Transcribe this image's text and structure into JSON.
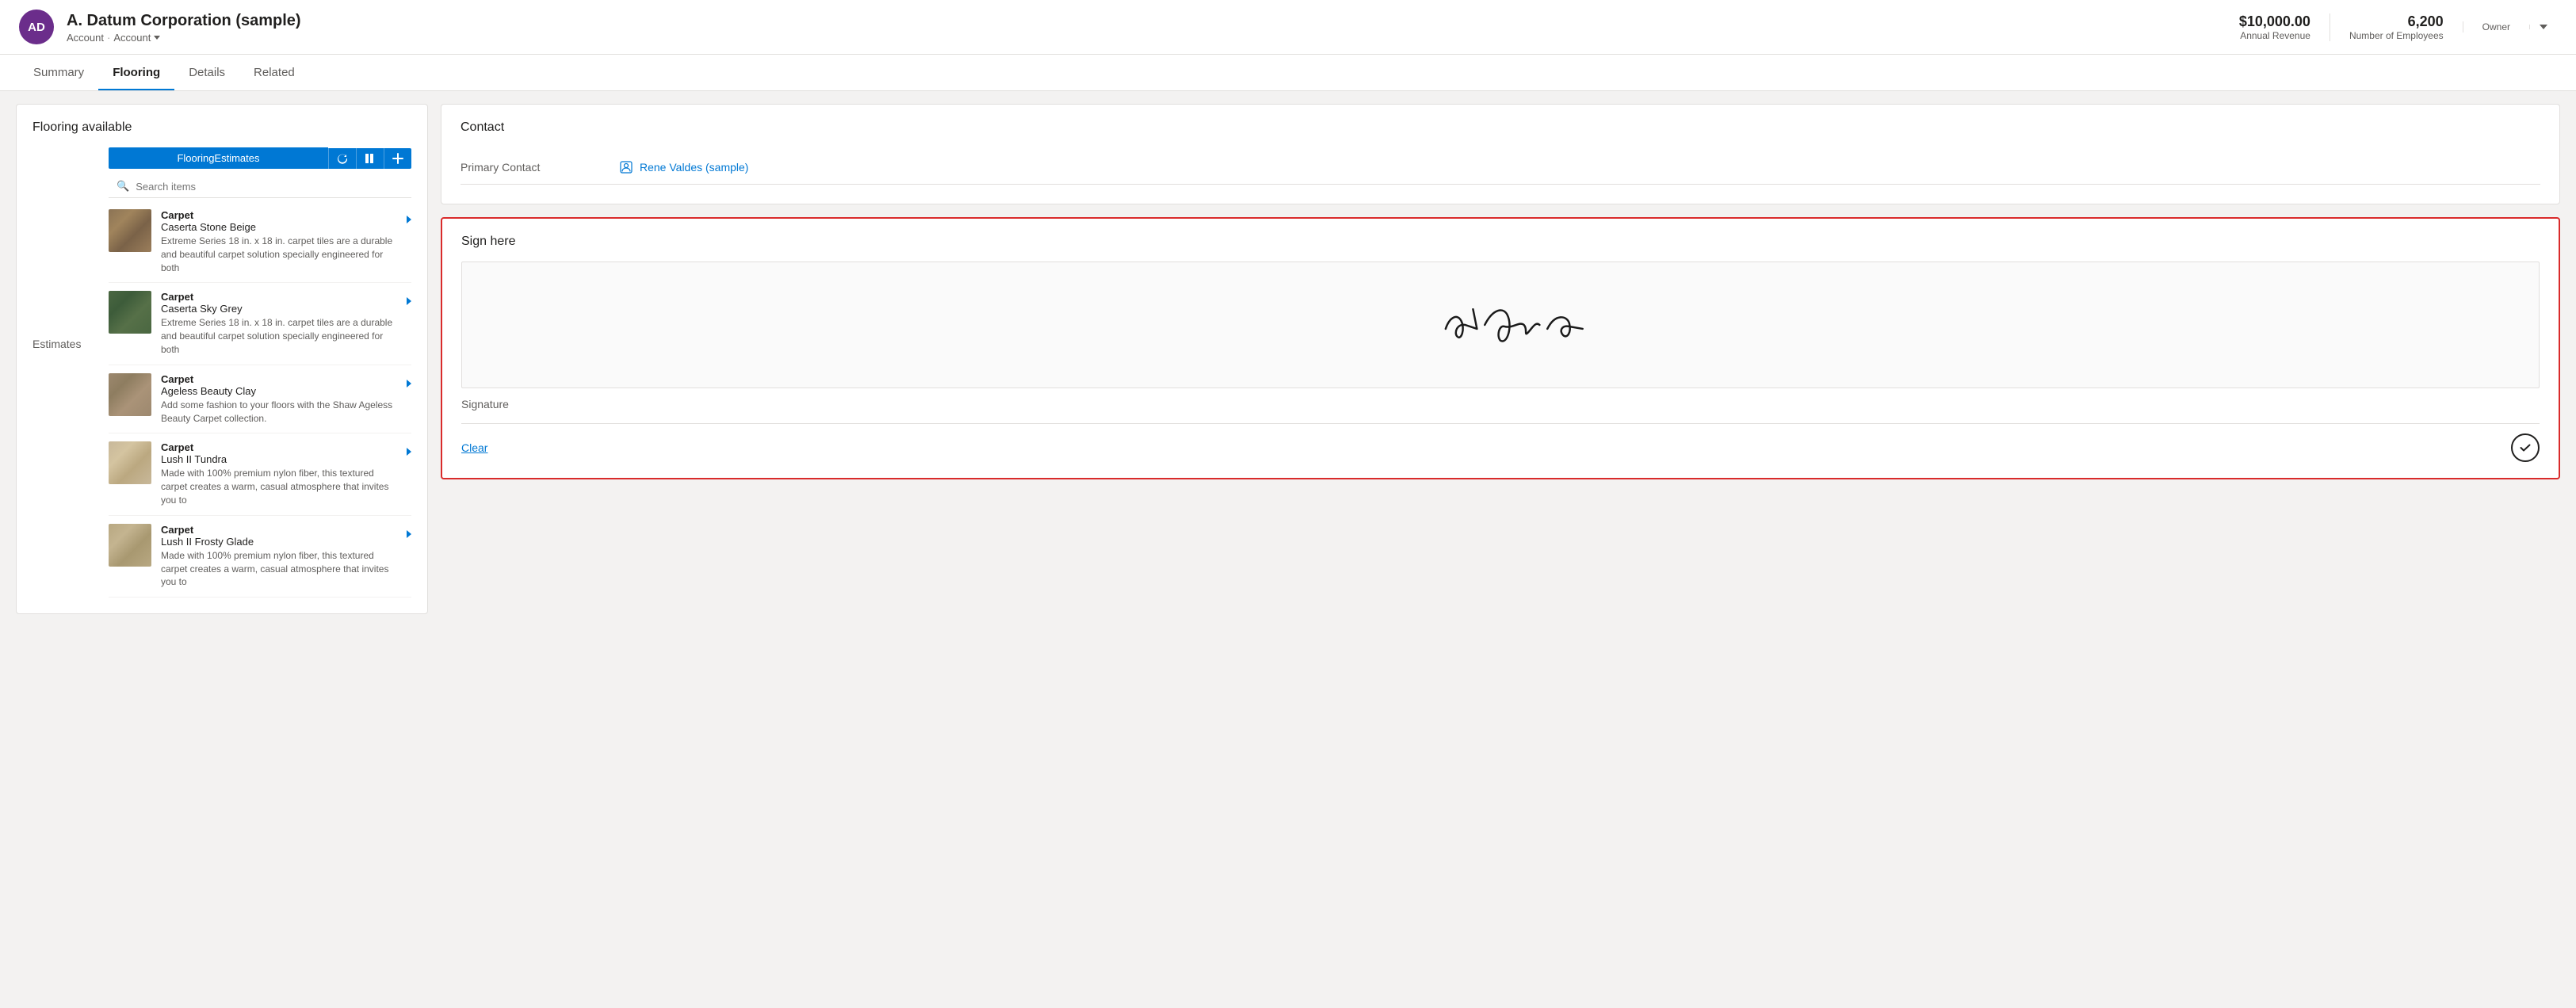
{
  "header": {
    "avatar_initials": "AD",
    "entity_name": "A. Datum Corporation (sample)",
    "breadcrumb1": "Account",
    "breadcrumb_sep": "·",
    "breadcrumb2": "Account",
    "annual_revenue_value": "$10,000.00",
    "annual_revenue_label": "Annual Revenue",
    "employees_value": "6,200",
    "employees_label": "Number of Employees",
    "owner_label": "Owner"
  },
  "tabs": [
    {
      "id": "summary",
      "label": "Summary",
      "active": false
    },
    {
      "id": "flooring",
      "label": "Flooring",
      "active": true
    },
    {
      "id": "details",
      "label": "Details",
      "active": false
    },
    {
      "id": "related",
      "label": "Related",
      "active": false
    }
  ],
  "flooring_panel": {
    "title": "Flooring available",
    "estimates_label": "Estimates",
    "subgrid_title": "FlooringEstimates",
    "search_placeholder": "Search items",
    "items": [
      {
        "type": "Carpet",
        "name": "Caserta Stone Beige",
        "description": "Extreme Series 18 in. x 18 in. carpet tiles are a durable and beautiful carpet solution specially engineered for both",
        "thumb_class": "thumb-caserta-beige"
      },
      {
        "type": "Carpet",
        "name": "Caserta Sky Grey",
        "description": "Extreme Series 18 in. x 18 in. carpet tiles are a durable and beautiful carpet solution specially engineered for both",
        "thumb_class": "thumb-caserta-grey"
      },
      {
        "type": "Carpet",
        "name": "Ageless Beauty Clay",
        "description": "Add some fashion to your floors with the Shaw Ageless Beauty Carpet collection.",
        "thumb_class": "thumb-ageless-clay"
      },
      {
        "type": "Carpet",
        "name": "Lush II Tundra",
        "description": "Made with 100% premium nylon fiber, this textured carpet creates a warm, casual atmosphere that invites you to",
        "thumb_class": "thumb-lush-tundra"
      },
      {
        "type": "Carpet",
        "name": "Lush II Frosty Glade",
        "description": "Made with 100% premium nylon fiber, this textured carpet creates a warm, casual atmosphere that invites you to",
        "thumb_class": "thumb-lush-frosty"
      }
    ]
  },
  "contact_panel": {
    "title": "Contact",
    "primary_contact_label": "Primary Contact",
    "primary_contact_value": "Rene Valdes (sample)"
  },
  "sign_panel": {
    "title": "Sign here",
    "signature_label": "Signature",
    "clear_label": "Clear"
  }
}
